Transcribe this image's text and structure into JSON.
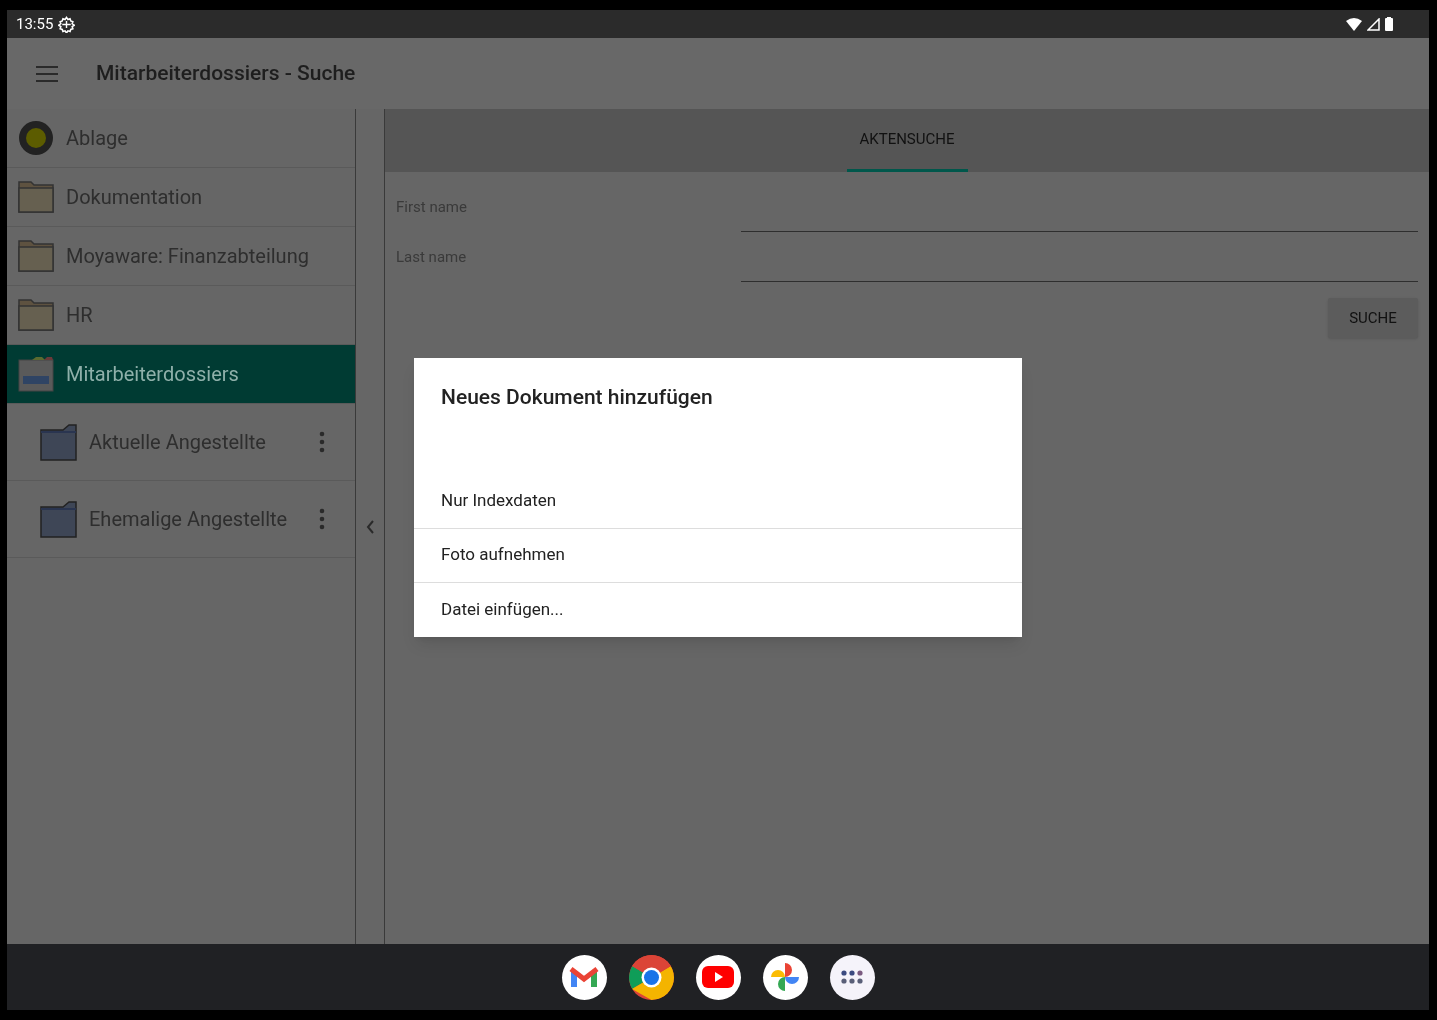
{
  "status_bar": {
    "time": "13:55"
  },
  "app_bar": {
    "title": "Mitarbeiterdossiers - Suche"
  },
  "sidebar": {
    "items": [
      {
        "label": "Ablage",
        "kind": "disk",
        "selected": false
      },
      {
        "label": "Dokumentation",
        "kind": "folder",
        "selected": false
      },
      {
        "label": "Moyaware: Finanzabteilung",
        "kind": "folder",
        "selected": false
      },
      {
        "label": "HR",
        "kind": "folder",
        "selected": false
      },
      {
        "label": "Mitarbeiterdossiers",
        "kind": "cabinet",
        "selected": true,
        "children": [
          {
            "label": "Aktuelle Angestellte",
            "kind": "subfolder",
            "selected": false
          },
          {
            "label": "Ehemalige Angestellte",
            "kind": "subfolder",
            "selected": false
          }
        ]
      }
    ]
  },
  "tabs": [
    {
      "label": "AKTENSUCHE",
      "selected": true
    }
  ],
  "form": {
    "fields": [
      {
        "label": "First name"
      },
      {
        "label": "Last name"
      }
    ],
    "button": "SUCHE"
  },
  "dialog": {
    "title": "Neues Dokument hinzufügen",
    "options": [
      "Nur Indexdaten",
      "Foto aufnehmen",
      "Datei einfügen..."
    ]
  }
}
